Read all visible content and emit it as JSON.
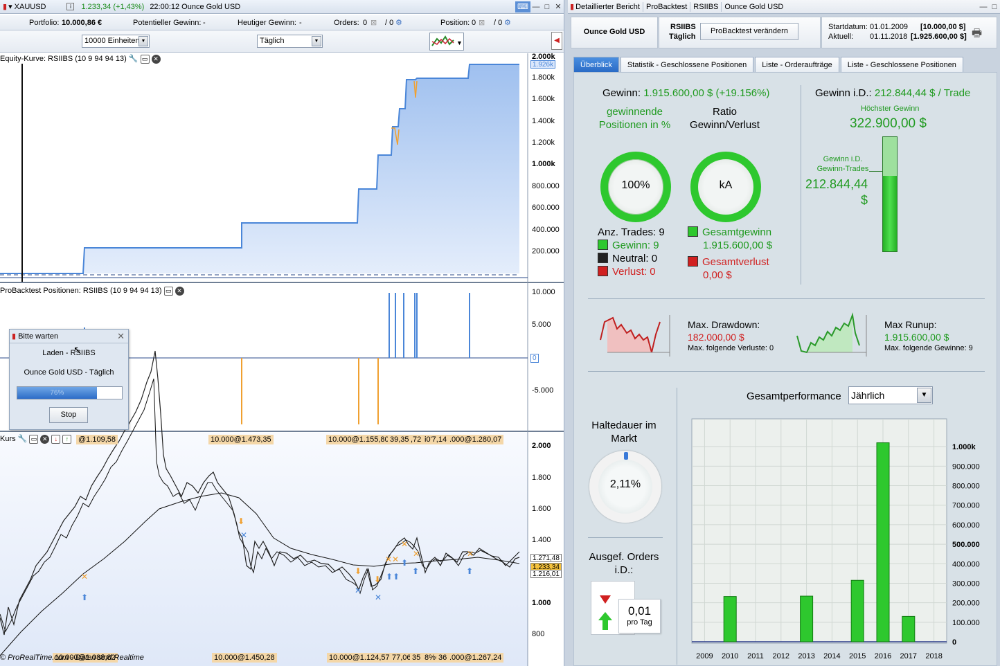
{
  "left_window": {
    "symbol": "XAUUSD",
    "quote": "1.233,34 (+1,43%)",
    "time_title": "22:00:12 Ounce Gold USD",
    "portfolio_label": "Portfolio:",
    "portfolio_value": "10.000,86 €",
    "pot_gain_label": "Potentieller Gewinn:",
    "pot_gain_value": "-",
    "day_gain_label": "Heutiger Gewinn:",
    "day_gain_value": "-",
    "orders_label": "Orders:",
    "orders_a": "0",
    "orders_b": "/ 0",
    "position_label": "Position:",
    "position_a": "0",
    "position_b": "/ 0",
    "units_select": "10000 Einheiten",
    "period_select": "Täglich"
  },
  "equity_panel": {
    "title": "Equity-Kurve: RSIIBS (10 9 94 94 13)",
    "axis": [
      "2.000k",
      "1.800k",
      "1.600k",
      "1.400k",
      "1.200k",
      "1.000k",
      "800.000",
      "600.000",
      "400.000",
      "200.000"
    ],
    "current": "1.926k"
  },
  "positions_panel": {
    "title": "ProBacktest Positionen: RSIIBS (10 9 94 94 13)",
    "axis": [
      "10.000",
      "5.000",
      "0",
      "-5.000"
    ]
  },
  "price_panel": {
    "title": "Kurs",
    "axis": [
      "2.000",
      "1.800",
      "1.600",
      "1.400",
      "1.200",
      "1.000",
      "800"
    ],
    "price_high": "1.271,48",
    "price_current": "1.233,34",
    "price_low": "1.216,01",
    "top_tags": [
      "@1.109,58",
      "10.000@1.473,35",
      "10.000@1.155,80",
      "39,35",
      ",72",
      "i0'7,14",
      ".000@1.280,07"
    ],
    "bottom_tags": [
      "10.000@1.088,82",
      "10.000@1.450,28",
      "10.000@1.124,57",
      "77,06",
      "35",
      "8%6",
      "36",
      ".000@1.267,24"
    ],
    "copyright": "© ProRealTime.com - Daten sind Realtime"
  },
  "wait_dialog": {
    "title": "Bitte warten",
    "line1": "Laden - RSIIBS",
    "line2": "Ounce Gold USD - Täglich",
    "progress_label": "76%",
    "progress": 0.76,
    "stop": "Stop"
  },
  "report": {
    "title": "Detaillierter Bericht",
    "crumbs": [
      "ProBacktest",
      "RSIIBS",
      "Ounce Gold USD"
    ],
    "instrument": "Ounce Gold USD",
    "system": "RSIIBS",
    "period": "Täglich",
    "modify_button": "ProBacktest verändern",
    "start_label": "Startdatum:",
    "start_date": "01.01.2009",
    "start_capital": "[10.000,00 $]",
    "current_label": "Aktuell:",
    "current_date": "01.11.2018",
    "current_capital": "[1.925.600,00 $]",
    "tabs": [
      "Überblick",
      "Statistik - Geschlossene Positionen",
      "Liste - Orderaufträge",
      "Liste - Geschlossene Positionen"
    ],
    "gain_label": "Gewinn:",
    "gain_value": "1.915.600,00 $ (+19.156%)",
    "winning_label": "gewinnende Positionen in %",
    "winning_value": "100%",
    "ratio_label": "Ratio Gewinn/Verlust",
    "ratio_value": "kA",
    "trades_label": "Anz. Trades: 9",
    "wins": "Gewinn: 9",
    "neutral": "Neutral: 0",
    "losses": "Verlust: 0",
    "total_gain_label": "Gesamtgewinn",
    "total_gain_value": "1.915.600,00 $",
    "total_loss_label": "Gesamtverlust",
    "total_loss_value": "0,00 $",
    "avg_gain_label": "Gewinn i.D.:",
    "avg_gain_value": "212.844,44 $ / Trade",
    "max_gain_label": "Höchster Gewinn",
    "max_gain_value": "322.900,00 $",
    "avg_win_label": "Gewinn i.D. Gewinn-Trades",
    "avg_win_value": "212.844,44 $",
    "drawdown_label": "Max. Drawdown:",
    "drawdown_value": "182.000,00 $",
    "drawdown_sub": "Max. folgende Verluste: 0",
    "runup_label": "Max Runup:",
    "runup_value": "1.915.600,00 $",
    "runup_sub": "Max. folgende Gewinne: 9",
    "hold_label": "Haltedauer im Markt",
    "hold_value": "2,11%",
    "orders_label": "Ausgef. Orders i.D.:",
    "orders_value": "0,01",
    "orders_unit": "pro Tag",
    "perf_label": "Gesamtperformance",
    "perf_select": "Jährlich"
  },
  "chart_data": {
    "type": "bar",
    "categories": [
      "2009",
      "2010",
      "2011",
      "2012",
      "2013",
      "2014",
      "2015",
      "2016",
      "2017",
      "2018"
    ],
    "values": [
      0,
      232000,
      0,
      0,
      234000,
      0,
      315000,
      1020000,
      130000,
      0
    ],
    "ylim": [
      0,
      1100000
    ],
    "yticks": [
      "1.000k",
      "900.000",
      "800.000",
      "700.000",
      "600.000",
      "500.000",
      "400.000",
      "300.000",
      "200.000",
      "100.000",
      "0"
    ],
    "ytick_values": [
      1000000,
      900000,
      800000,
      700000,
      600000,
      500000,
      400000,
      300000,
      200000,
      100000,
      0
    ]
  }
}
